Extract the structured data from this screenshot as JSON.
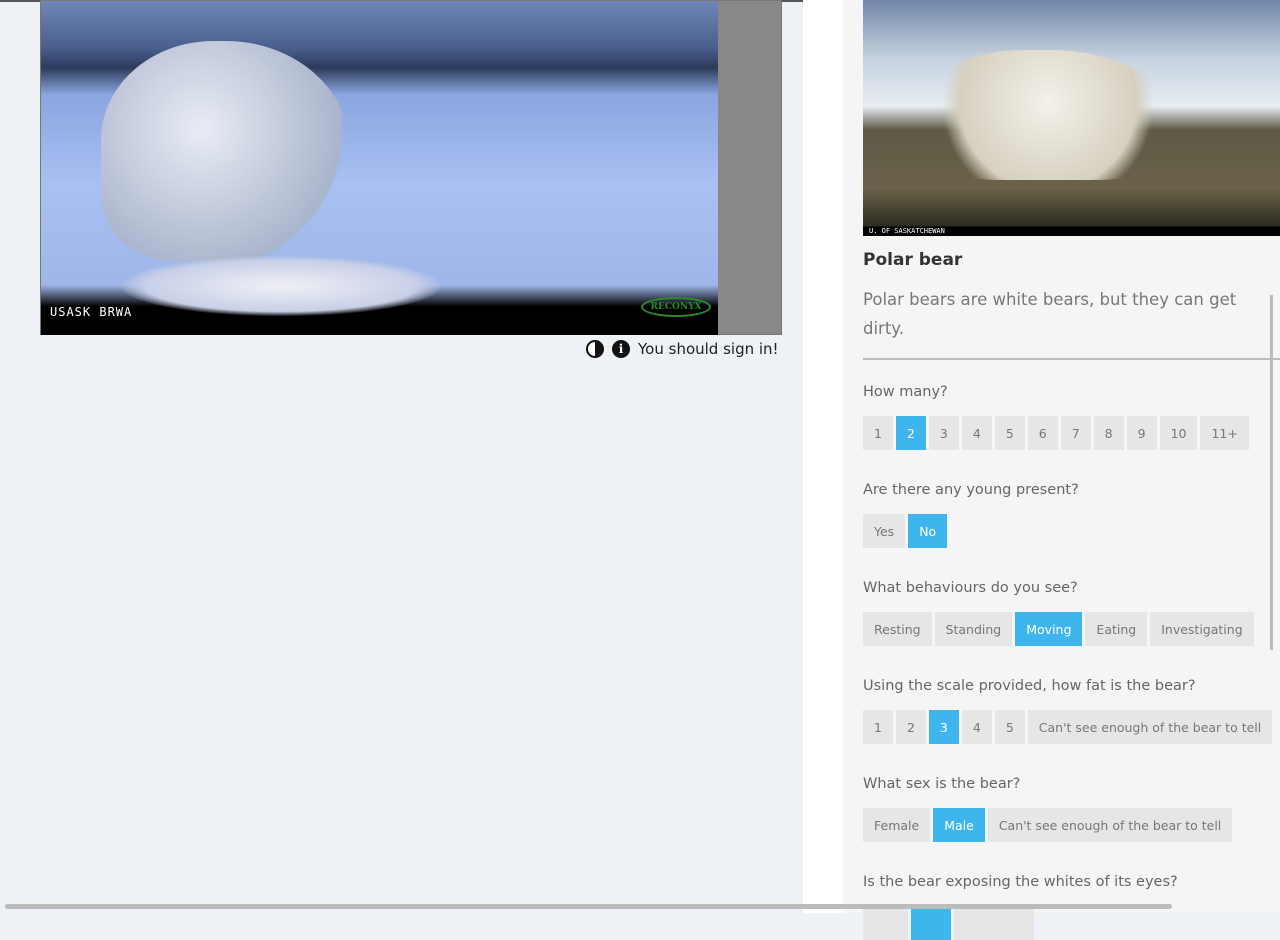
{
  "subject": {
    "camera_label": "USASK BRWA",
    "logo": "RECONYX"
  },
  "tools": {
    "contrast_icon": "contrast-icon",
    "info_icon": "info-icon",
    "sign_in_message": "You should sign in!"
  },
  "species": {
    "reference_caption": "U. OF SASKATCHEWAN",
    "name": "Polar bear",
    "description": "Polar bears are white bears, but they can get dirty."
  },
  "colors": {
    "selected": "#3fb5ee",
    "unselected": "#e6e6e6"
  },
  "questions": [
    {
      "label": "How many?",
      "options": [
        "1",
        "2",
        "3",
        "4",
        "5",
        "6",
        "7",
        "8",
        "9",
        "10",
        "11+"
      ],
      "selected": "2"
    },
    {
      "label": "Are there any young present?",
      "options": [
        "Yes",
        "No"
      ],
      "selected": "No"
    },
    {
      "label": "What behaviours do you see?",
      "options": [
        "Resting",
        "Standing",
        "Moving",
        "Eating",
        "Investigating"
      ],
      "selected": "Moving"
    },
    {
      "label": "Using the scale provided, how fat is the bear?",
      "options": [
        "1",
        "2",
        "3",
        "4",
        "5",
        "Can't see enough of the bear to tell"
      ],
      "selected": "3"
    },
    {
      "label": "What sex is the bear?",
      "options": [
        "Female",
        "Male",
        "Can't see enough of the bear to tell"
      ],
      "selected": "Male"
    },
    {
      "label": "Is the bear exposing the whites of its eyes?"
    }
  ]
}
